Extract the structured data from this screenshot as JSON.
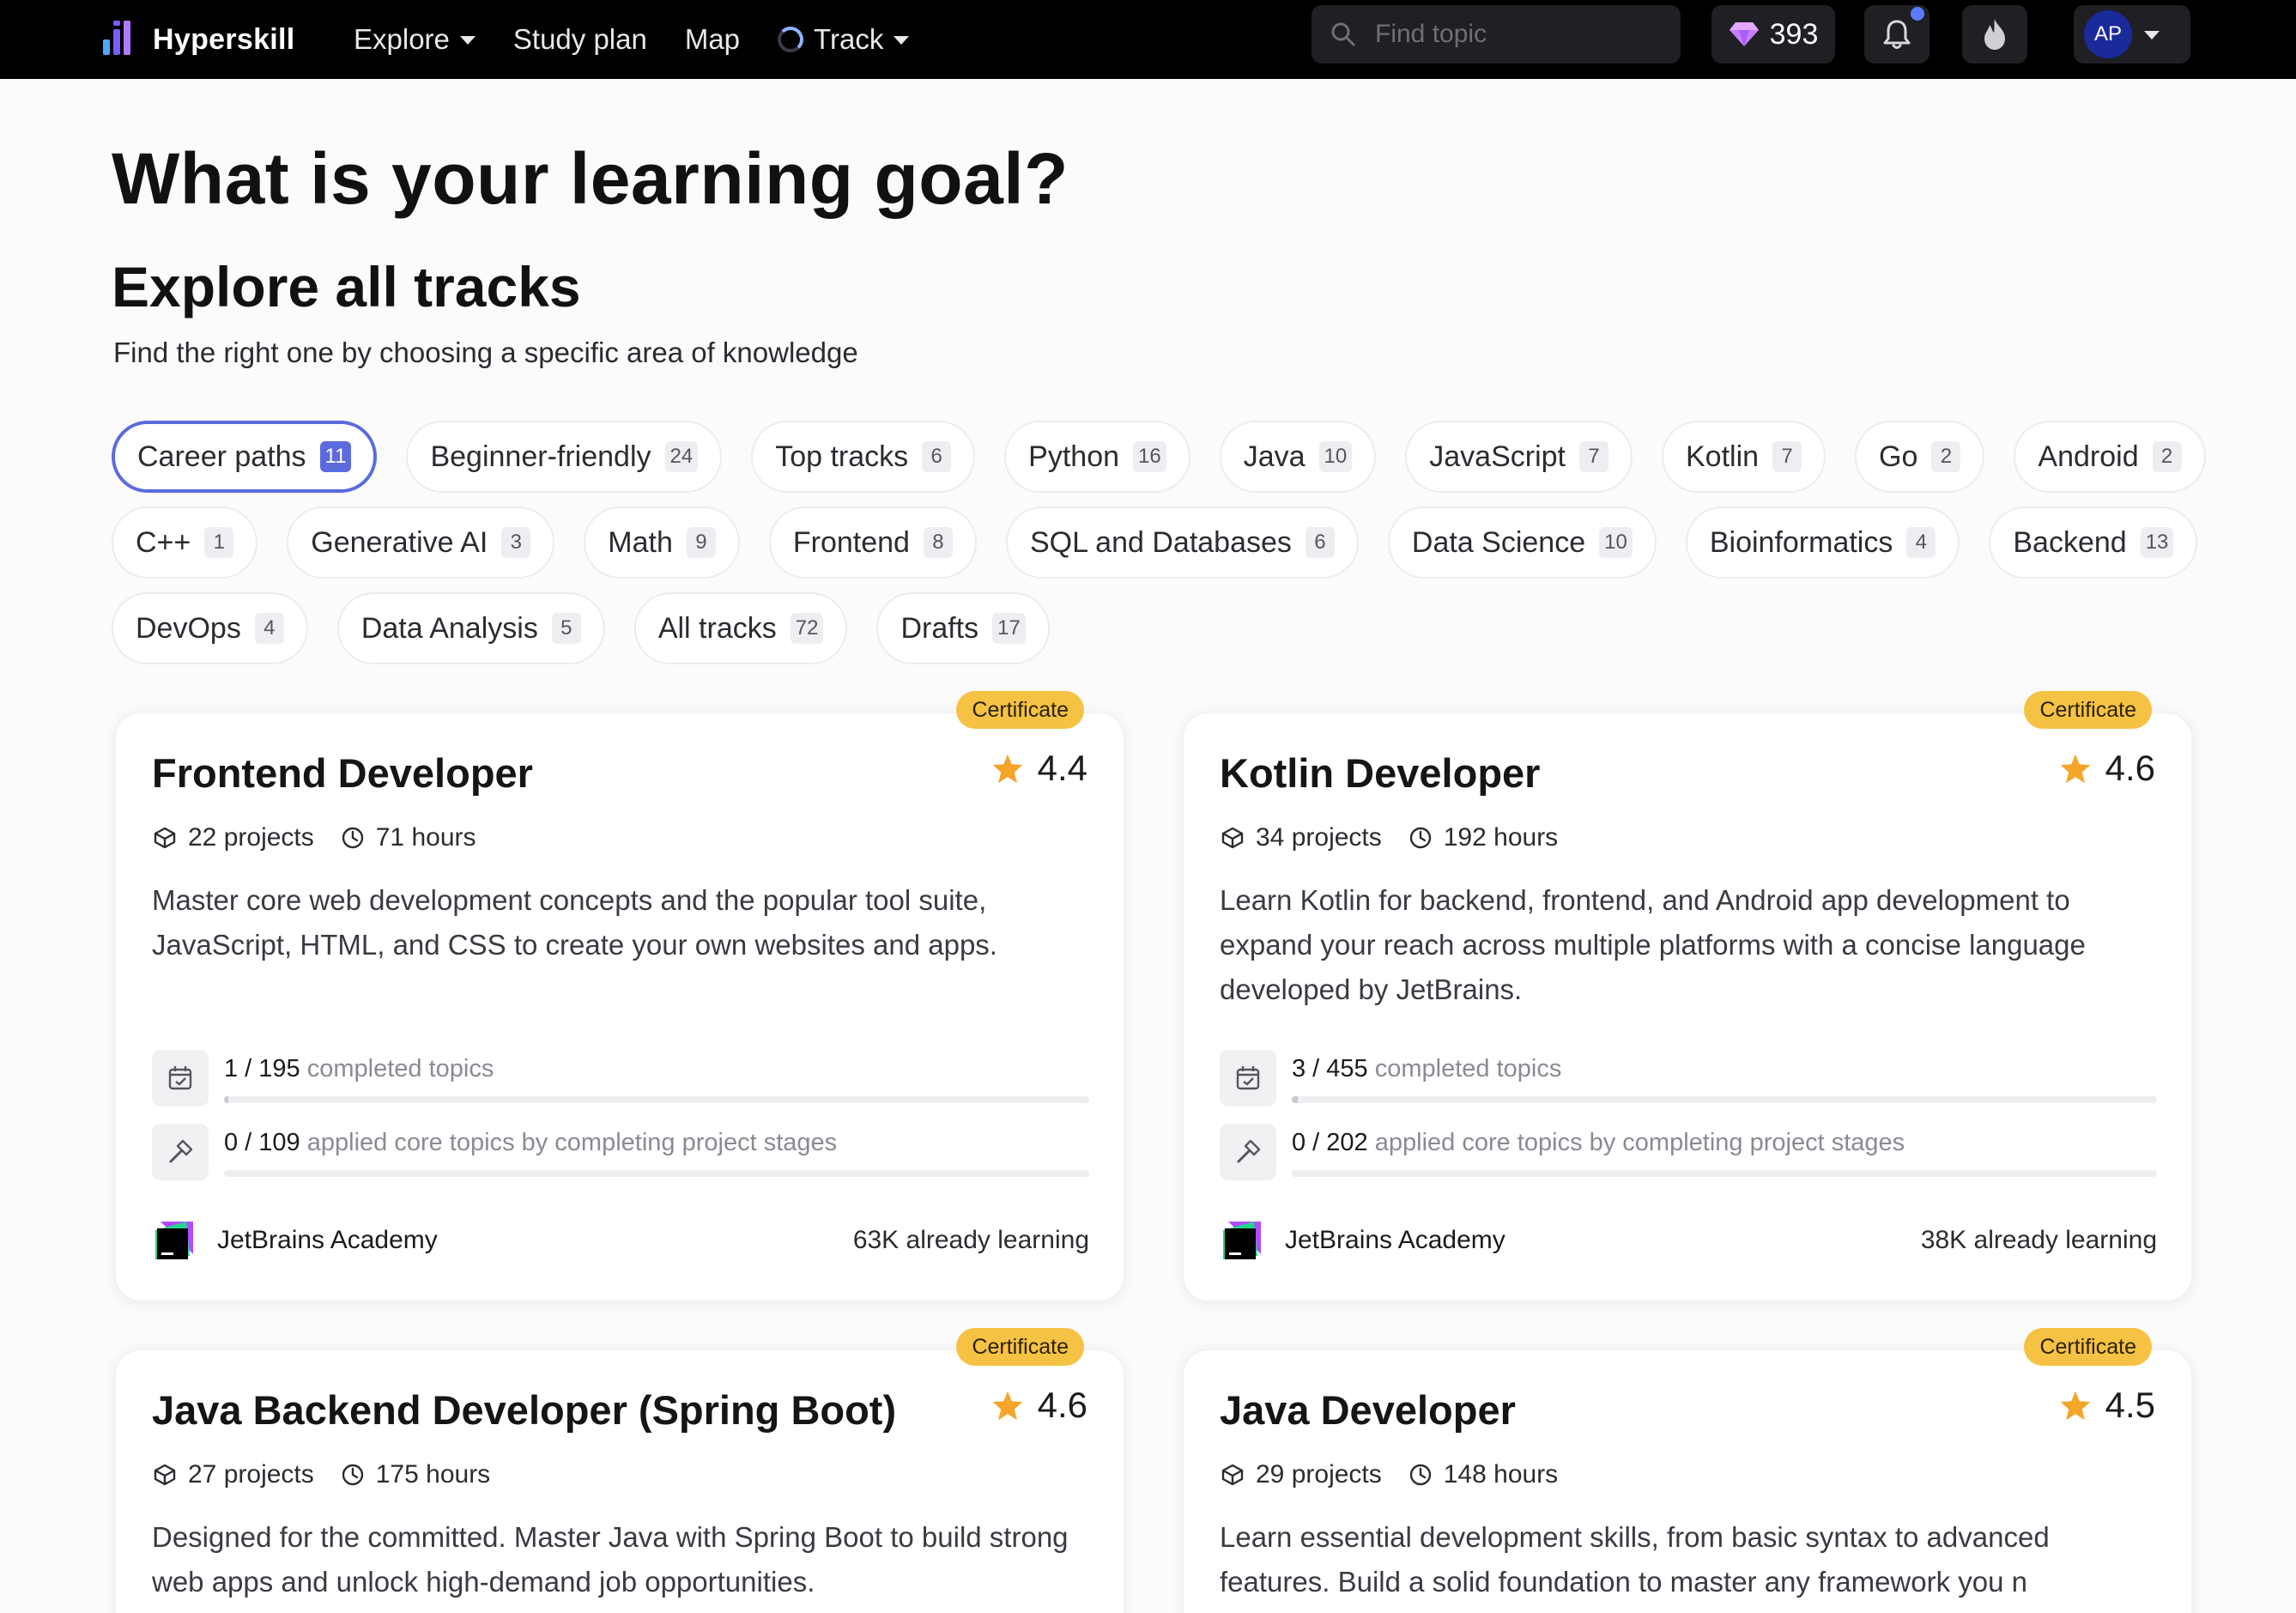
{
  "app": {
    "name": "Hyperskill"
  },
  "nav": {
    "explore": "Explore",
    "study_plan": "Study plan",
    "map": "Map",
    "track": "Track"
  },
  "search": {
    "placeholder": "Find topic"
  },
  "gems": {
    "count": "393"
  },
  "user": {
    "initials": "AP"
  },
  "colors": {
    "accent": "#5b6bde",
    "certificate": "#f6c244",
    "star": "#f4a52a",
    "topbar": "#000000"
  },
  "page": {
    "title": "What is your learning goal?",
    "section_title": "Explore all tracks",
    "section_subtitle": "Find the right one by choosing a specific area of knowledge"
  },
  "filters": [
    {
      "label": "Career paths",
      "count": "11",
      "active": true
    },
    {
      "label": "Beginner-friendly",
      "count": "24"
    },
    {
      "label": "Top tracks",
      "count": "6"
    },
    {
      "label": "Python",
      "count": "16"
    },
    {
      "label": "Java",
      "count": "10"
    },
    {
      "label": "JavaScript",
      "count": "7"
    },
    {
      "label": "Kotlin",
      "count": "7"
    },
    {
      "label": "Go",
      "count": "2"
    },
    {
      "label": "Android",
      "count": "2"
    },
    {
      "label": "C++",
      "count": "1"
    },
    {
      "label": "Generative AI",
      "count": "3"
    },
    {
      "label": "Math",
      "count": "9"
    },
    {
      "label": "Frontend",
      "count": "8"
    },
    {
      "label": "SQL and Databases",
      "count": "6"
    },
    {
      "label": "Data Science",
      "count": "10"
    },
    {
      "label": "Bioinformatics",
      "count": "4"
    },
    {
      "label": "Backend",
      "count": "13"
    },
    {
      "label": "DevOps",
      "count": "4"
    },
    {
      "label": "Data Analysis",
      "count": "5"
    },
    {
      "label": "All tracks",
      "count": "72"
    },
    {
      "label": "Drafts",
      "count": "17"
    }
  ],
  "tracks": [
    {
      "badge": "Certificate",
      "title": "Frontend Developer",
      "rating": "4.4",
      "projects": "22 projects",
      "hours": "71 hours",
      "description": "Master core web development concepts and the popular tool suite, JavaScript, HTML, and CSS to create your own websites and apps.",
      "topics_done": "1 / 195",
      "topics_label": "completed topics",
      "topics_fraction": 0.005,
      "applied_done": "0 / 109",
      "applied_label": "applied core topics by completing project stages",
      "applied_fraction": 0,
      "provider": "JetBrains Academy",
      "learners": "63K already learning"
    },
    {
      "badge": "Certificate",
      "title": "Kotlin Developer",
      "rating": "4.6",
      "projects": "34 projects",
      "hours": "192 hours",
      "description": "Learn Kotlin for backend, frontend, and Android app development to expand your reach across multiple platforms with a concise language developed by JetBrains.",
      "topics_done": "3 / 455",
      "topics_label": "completed topics",
      "topics_fraction": 0.007,
      "applied_done": "0 / 202",
      "applied_label": "applied core topics by completing project stages",
      "applied_fraction": 0,
      "provider": "JetBrains Academy",
      "learners": "38K already learning"
    },
    {
      "badge": "Certificate",
      "title": "Java Backend Developer (Spring Boot)",
      "rating": "4.6",
      "projects": "27 projects",
      "hours": "175 hours",
      "description": "Designed for the committed. Master Java with Spring Boot to build strong web apps and unlock high-demand job opportunities."
    },
    {
      "badge": "Certificate",
      "title": "Java Developer",
      "rating": "4.5",
      "projects": "29 projects",
      "hours": "148 hours",
      "description": "Learn essential development skills, from basic syntax to advanced features. Build a solid foundation to master any framework you n"
    }
  ]
}
